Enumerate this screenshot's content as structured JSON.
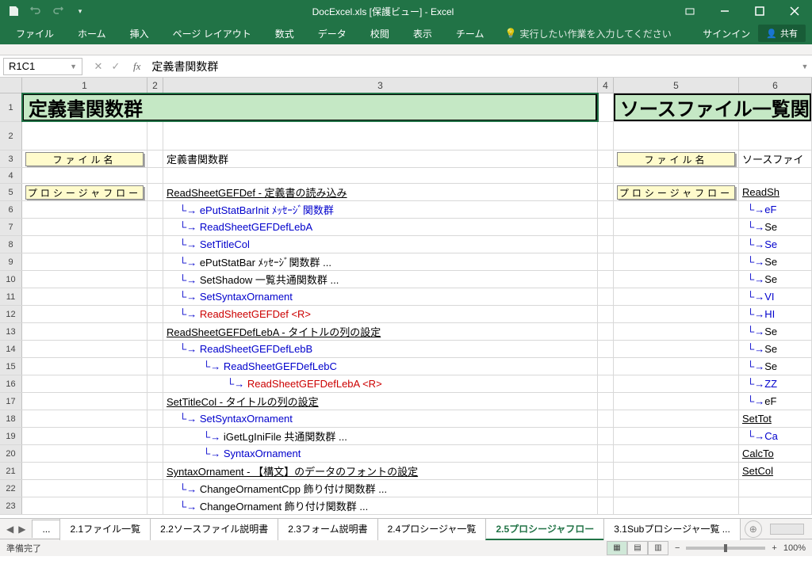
{
  "title": "DocExcel.xls [保護ビュー] - Excel",
  "ribbon": {
    "tabs": [
      "ファイル",
      "ホーム",
      "挿入",
      "ページ レイアウト",
      "数式",
      "データ",
      "校閲",
      "表示",
      "チーム"
    ],
    "tellme": "実行したい作業を入力してください",
    "signin": "サインイン",
    "share": "共有"
  },
  "namebox": "R1C1",
  "formula": "定義書関数群",
  "columns": [
    "1",
    "2",
    "3",
    "4",
    "5",
    "6"
  ],
  "row_numbers": [
    "1",
    "2",
    "3",
    "4",
    "5",
    "6",
    "7",
    "8",
    "9",
    "10",
    "11",
    "12",
    "13",
    "14",
    "15",
    "16",
    "17",
    "18",
    "19",
    "20",
    "21",
    "22",
    "23"
  ],
  "banner1": "定義書関数群",
  "banner2": "ソースファイル一覧関数",
  "labels": {
    "filename": "ファイル名",
    "procflow": "プロシージャフロー"
  },
  "r3c3": "定義書関数群",
  "r3c6": "ソースファイ",
  "flow": [
    {
      "indent": 0,
      "arrow": "",
      "cls": "black ul",
      "text": "ReadSheetGEFDef - 定義書の読み込み"
    },
    {
      "indent": 1,
      "arrow": "blue",
      "cls": "blue",
      "text": "ePutStatBarInit ﾒｯｾｰｼﾞ関数群"
    },
    {
      "indent": 1,
      "arrow": "blue",
      "cls": "blue",
      "text": "ReadSheetGEFDefLebA"
    },
    {
      "indent": 1,
      "arrow": "blue",
      "cls": "blue",
      "text": "SetTitleCol"
    },
    {
      "indent": 1,
      "arrow": "black",
      "cls": "black",
      "text": "ePutStatBar ﾒｯｾｰｼﾞ関数群 ..."
    },
    {
      "indent": 1,
      "arrow": "black",
      "cls": "black",
      "text": "SetShadow 一覧共通関数群 ..."
    },
    {
      "indent": 1,
      "arrow": "blue",
      "cls": "blue",
      "text": "SetSyntaxOrnament"
    },
    {
      "indent": 1,
      "arrow": "red",
      "cls": "red",
      "text": "ReadSheetGEFDef <R>"
    },
    {
      "indent": 0,
      "arrow": "",
      "cls": "black ul",
      "text": "ReadSheetGEFDefLebA - タイトルの列の設定"
    },
    {
      "indent": 1,
      "arrow": "blue",
      "cls": "blue",
      "text": "ReadSheetGEFDefLebB"
    },
    {
      "indent": 2,
      "arrow": "blue",
      "cls": "blue",
      "text": "ReadSheetGEFDefLebC"
    },
    {
      "indent": 3,
      "arrow": "red",
      "cls": "red",
      "text": "ReadSheetGEFDefLebA <R>"
    },
    {
      "indent": 0,
      "arrow": "",
      "cls": "black ul",
      "text": "SetTitleCol - タイトルの列の設定"
    },
    {
      "indent": 1,
      "arrow": "blue",
      "cls": "blue",
      "text": "SetSyntaxOrnament"
    },
    {
      "indent": 2,
      "arrow": "black",
      "cls": "black",
      "text": "iGetLgIniFile 共通関数群 ..."
    },
    {
      "indent": 2,
      "arrow": "blue",
      "cls": "blue",
      "text": "SyntaxOrnament"
    },
    {
      "indent": 0,
      "arrow": "",
      "cls": "black ul",
      "text": "SyntaxOrnament - 【構文】のデータのフォントの設定"
    },
    {
      "indent": 1,
      "arrow": "black",
      "cls": "black",
      "text": "ChangeOrnamentCpp 飾り付け関数群 ..."
    },
    {
      "indent": 1,
      "arrow": "black",
      "cls": "black",
      "text": "ChangeOrnament 飾り付け関数群 ..."
    }
  ],
  "flow_right": [
    {
      "cls": "black ul",
      "text": "ReadSh"
    },
    {
      "arrow": "blue",
      "cls": "blue",
      "text": "eF"
    },
    {
      "arrow": "black",
      "cls": "black",
      "text": "Se"
    },
    {
      "arrow": "blue",
      "cls": "blue",
      "text": "Se"
    },
    {
      "arrow": "black",
      "cls": "black",
      "text": "Se"
    },
    {
      "arrow": "black",
      "cls": "black",
      "text": "Se"
    },
    {
      "arrow": "blue",
      "cls": "blue",
      "text": "VI"
    },
    {
      "arrow": "blue",
      "cls": "blue",
      "text": "HI"
    },
    {
      "arrow": "black",
      "cls": "black",
      "text": "Se"
    },
    {
      "arrow": "black",
      "cls": "black",
      "text": "Se"
    },
    {
      "arrow": "black",
      "cls": "black",
      "text": "Se"
    },
    {
      "arrow": "blue",
      "cls": "blue",
      "text": "ZZ"
    },
    {
      "arrow": "black",
      "cls": "black",
      "text": "eF"
    },
    {
      "cls": "black ul",
      "text": "SetTot"
    },
    {
      "arrow": "blue",
      "cls": "blue",
      "text": "Ca"
    },
    {
      "cls": "black ul",
      "text": "CalcTo"
    },
    {
      "cls": "black ul",
      "text": "SetCol"
    }
  ],
  "sheet_tabs": {
    "ellipsis": "...",
    "items": [
      "2.1ファイル一覧",
      "2.2ソースファイル説明書",
      "2.3フォーム説明書",
      "2.4プロシージャ一覧",
      "2.5プロシージャフロー",
      "3.1Subプロシージャ一覧 ..."
    ],
    "active": 4
  },
  "status": {
    "ready": "準備完了",
    "zoom": "100%"
  }
}
